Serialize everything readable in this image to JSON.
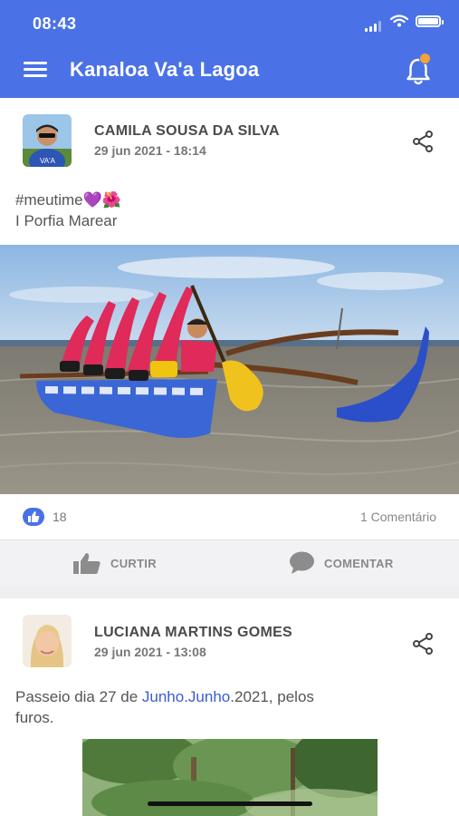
{
  "status_bar": {
    "time": "08:43"
  },
  "header": {
    "title": "Kanaloa Va'a Lagoa",
    "menu_icon": "hamburger-menu-icon",
    "bell_icon": "bell-icon",
    "accent_color": "#4a72e6"
  },
  "posts": [
    {
      "author": "CAMILA SOUSA DA SILVA",
      "date": "29 jun 2021 - 18:14",
      "text_line1": "#meutime💜🌺",
      "text_line2": "I Porfia Marear",
      "likes": "18",
      "comments": "1 Comentário",
      "like_label": "CURTIR",
      "comment_label": "COMENTAR"
    },
    {
      "author": "LUCIANA MARTINS GOMES",
      "date": "29 jun 2021 - 13:08",
      "text_prefix": "Passeio dia 27 de ",
      "text_link": "Junho.Junho",
      "text_suffix": ".2021, pelos",
      "text_line2": "furos."
    }
  ]
}
